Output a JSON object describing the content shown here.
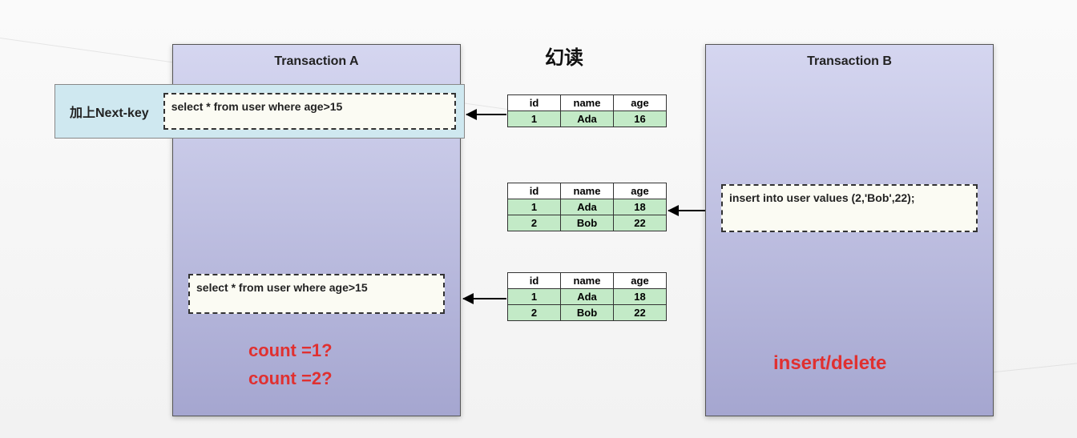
{
  "title": "幻读",
  "transactionA": {
    "title": "Transaction A",
    "nextKeyLabel": "加上Next-key",
    "sql1": "select * from user where age>15",
    "sql2": "select * from user where age>15",
    "count1": "count =1?",
    "count2": "count =2?"
  },
  "transactionB": {
    "title": "Transaction B",
    "sql": "insert into user values (2,'Bob',22);",
    "action": "insert/delete"
  },
  "tables": {
    "headers": [
      "id",
      "name",
      "age"
    ],
    "t1": [
      [
        "1",
        "Ada",
        "16"
      ]
    ],
    "t2": [
      [
        "1",
        "Ada",
        "18"
      ],
      [
        "2",
        "Bob",
        "22"
      ]
    ],
    "t3": [
      [
        "1",
        "Ada",
        "18"
      ],
      [
        "2",
        "Bob",
        "22"
      ]
    ]
  }
}
